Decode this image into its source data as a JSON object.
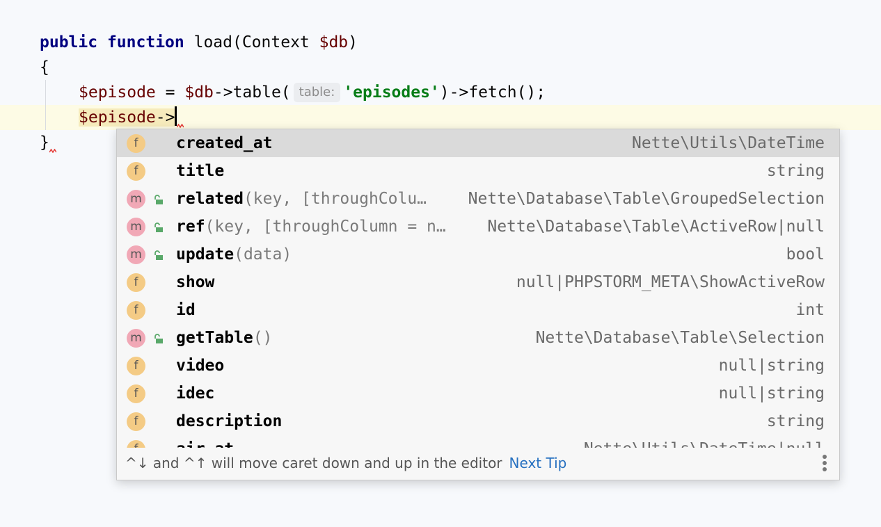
{
  "editor": {
    "line1": {
      "kw1": "public",
      "kw2": "function",
      "name": "load(Context ",
      "param": "$db",
      "close": ")"
    },
    "line2": {
      "text": "{"
    },
    "line3": {
      "var": "$episode",
      "assign": " = ",
      "db": "$db",
      "call": "->table(",
      "hint": "table:",
      "string": "'episodes'",
      "rest": ")->fetch();"
    },
    "line4": {
      "var": "$episode",
      "arrow": "->"
    },
    "line5": {
      "text": "}"
    }
  },
  "completion": {
    "items": [
      {
        "kind": "f",
        "name": "created_at",
        "params": "",
        "type": "Nette\\Utils\\DateTime",
        "locked": false,
        "selected": true
      },
      {
        "kind": "f",
        "name": "title",
        "params": "",
        "type": "string",
        "locked": false
      },
      {
        "kind": "m",
        "name": "related",
        "params": "(key, [throughColu…",
        "type": "Nette\\Database\\Table\\GroupedSelection",
        "locked": true
      },
      {
        "kind": "m",
        "name": "ref",
        "params": "(key, [throughColumn = n…",
        "type": "Nette\\Database\\Table\\ActiveRow|null",
        "locked": true
      },
      {
        "kind": "m",
        "name": "update",
        "params": "(data)",
        "type": "bool",
        "locked": true
      },
      {
        "kind": "f",
        "name": "show",
        "params": "",
        "type": "null|PHPSTORM_META\\ShowActiveRow",
        "locked": false
      },
      {
        "kind": "f",
        "name": "id",
        "params": "",
        "type": "int",
        "locked": false
      },
      {
        "kind": "m",
        "name": "getTable",
        "params": "()",
        "type": "Nette\\Database\\Table\\Selection",
        "locked": true
      },
      {
        "kind": "f",
        "name": "video",
        "params": "",
        "type": "null|string",
        "locked": false
      },
      {
        "kind": "f",
        "name": "idec",
        "params": "",
        "type": "null|string",
        "locked": false
      },
      {
        "kind": "f",
        "name": "description",
        "params": "",
        "type": "string",
        "locked": false
      },
      {
        "kind": "f",
        "name": "air_at",
        "params": "",
        "type": "Nette\\Utils\\DateTime|null",
        "locked": false
      }
    ],
    "footer": {
      "tip": "^↓ and ^↑ will move caret down and up in the editor",
      "next_tip": "Next Tip"
    }
  },
  "colors": {
    "keyword": "#000080",
    "variable": "#660000",
    "string": "#067d17",
    "field_badge": "#f4cb85",
    "method_badge": "#f1a8b6",
    "link": "#2670c0"
  }
}
